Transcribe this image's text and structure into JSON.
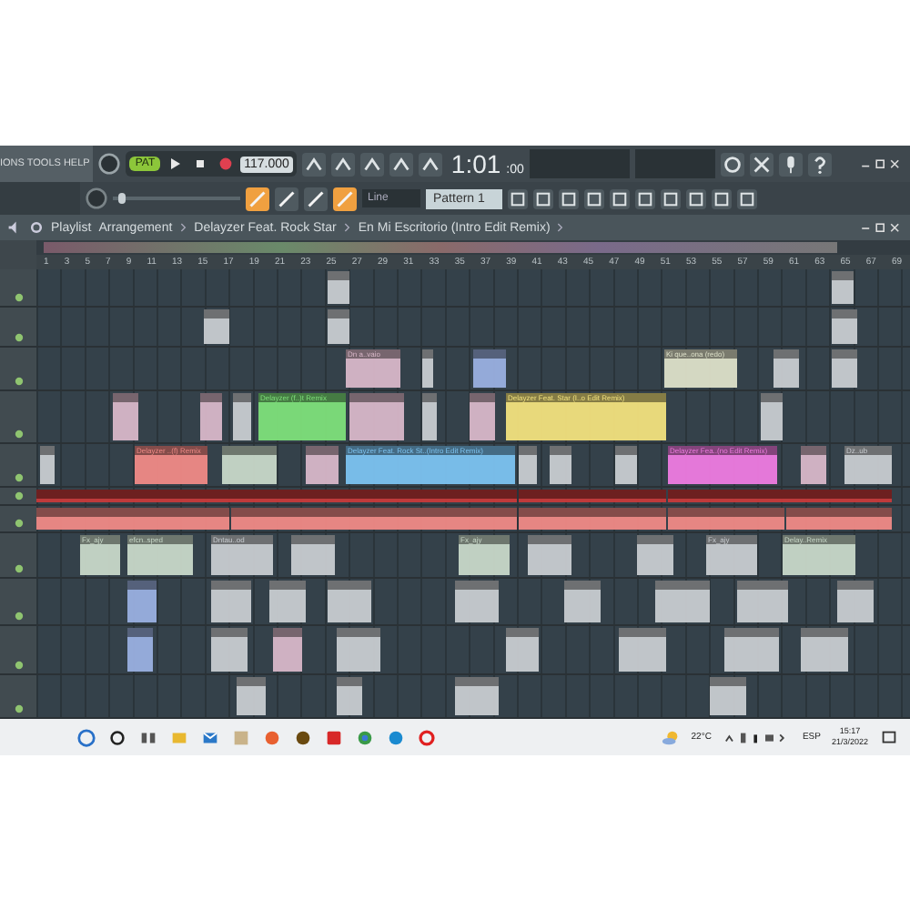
{
  "menu": {
    "text": "IONS TOOLS HELP"
  },
  "transport": {
    "mode": "PAT",
    "tempo": "117.000",
    "time": "1:01",
    "time_small": ":00"
  },
  "master": {
    "level": 0.05
  },
  "pattern": {
    "name": "Pattern 1"
  },
  "snap": {
    "value": "Line"
  },
  "playlist": {
    "title": "Playlist",
    "breadcrumb": [
      "Arrangement",
      "Delayzer Feat. Rock Star",
      "En Mi Escritorio (Intro Edit Remix)"
    ]
  },
  "ruler": [
    "1",
    "3",
    "5",
    "7",
    "9",
    "11",
    "13",
    "15",
    "17",
    "19",
    "21",
    "23",
    "25",
    "27",
    "29",
    "31",
    "33",
    "35",
    "37",
    "39",
    "41",
    "43",
    "45",
    "47",
    "49",
    "51",
    "53",
    "55",
    "57",
    "59",
    "61",
    "63",
    "65",
    "67",
    "69"
  ],
  "tracks": [
    {
      "clips": [
        {
          "color": "#c8ccd0"
        },
        {
          "color": "#c8ccd0"
        }
      ]
    },
    {
      "clips": [
        {
          "color": "#c8ccd0"
        },
        {
          "color": "#c8ccd0"
        },
        {
          "color": "#c8ccd0"
        }
      ]
    },
    {
      "clips": [
        {
          "label": "Dn a..vaio",
          "color": "#d8b7c8"
        },
        {
          "color": "#c8ccd0"
        },
        {
          "color": "#9ab0e0"
        },
        {
          "label": "Ki que..ona (redo)",
          "color": "#dde0c8"
        },
        {
          "color": "#c8ccd0"
        },
        {
          "color": "#c8ccd0"
        }
      ]
    },
    {
      "clips": [
        {
          "color": "#d8b7c8"
        },
        {
          "color": "#d8b7c8"
        },
        {
          "color": "#c8ccd0"
        },
        {
          "label": "Delayzer (f..)t Remix",
          "color": "#7ee07a"
        },
        {
          "color": "#d8b7c8"
        },
        {
          "color": "#c8ccd0"
        },
        {
          "color": "#d8b7c8"
        },
        {
          "label": "Delayzer Feat. Star (I..o Edit Remix)",
          "color": "#f2e27d"
        },
        {
          "color": "#c8ccd0"
        }
      ]
    },
    {
      "clips": [
        {
          "color": "#c8ccd0"
        },
        {
          "label": "Delayzer ..(f) Remix",
          "color": "#f08a86"
        },
        {
          "color": "#c8d8c8"
        },
        {
          "color": "#d8b7c8"
        },
        {
          "label": "Delayzer Feat. Rock St..(Intro Edit Remix)",
          "color": "#7cc3f0"
        },
        {
          "color": "#c8ccd0"
        },
        {
          "color": "#c8ccd0"
        },
        {
          "color": "#c8ccd0"
        },
        {
          "label": "Delayzer Fea..(no Edit Remix)",
          "color": "#ee7be0"
        },
        {
          "color": "#d8b7c8"
        },
        {
          "label": "Dz..ub",
          "color": "#c8ccd0"
        }
      ]
    },
    {
      "clips": [
        {
          "color": "#c73a3a"
        },
        {
          "color": "#c73a3a"
        },
        {
          "color": "#c73a3a"
        }
      ]
    },
    {
      "clips": [
        {
          "color": "#f08a86"
        },
        {
          "color": "#f08a86"
        },
        {
          "color": "#f08a86"
        },
        {
          "color": "#f08a86"
        },
        {
          "color": "#f08a86"
        }
      ]
    },
    {
      "clips": [
        {
          "label": "Fx_ajy",
          "color": "#c8d8c8"
        },
        {
          "label": "efcn..sped",
          "color": "#c8d8c8"
        },
        {
          "label": "Dntau..od",
          "color": "#c8ccd0"
        },
        {
          "color": "#c8ccd0"
        },
        {
          "label": "Fx_ajy",
          "color": "#c8d8c8"
        },
        {
          "color": "#c8ccd0"
        },
        {
          "color": "#c8ccd0"
        },
        {
          "label": "Fx_ajy",
          "color": "#c8ccd0"
        },
        {
          "label": "Delay..Remix",
          "color": "#c8d8c8"
        }
      ]
    },
    {
      "clips": [
        {
          "color": "#9ab0e0"
        },
        {
          "color": "#c8ccd0"
        },
        {
          "color": "#c8ccd0"
        },
        {
          "color": "#c8ccd0"
        },
        {
          "color": "#c8ccd0"
        },
        {
          "color": "#c8ccd0"
        },
        {
          "color": "#c8ccd0"
        },
        {
          "color": "#c8ccd0"
        },
        {
          "color": "#c8ccd0"
        }
      ]
    },
    {
      "clips": [
        {
          "color": "#9ab0e0"
        },
        {
          "color": "#c8ccd0"
        },
        {
          "color": "#d8b7c8"
        },
        {
          "color": "#c8ccd0"
        },
        {
          "color": "#c8ccd0"
        },
        {
          "color": "#c8ccd0"
        },
        {
          "color": "#c8ccd0"
        },
        {
          "color": "#c8ccd0"
        }
      ]
    },
    {
      "clips": [
        {
          "color": "#c8ccd0"
        },
        {
          "color": "#c8ccd0"
        },
        {
          "color": "#c8ccd0"
        },
        {
          "color": "#c8ccd0"
        }
      ]
    }
  ],
  "taskbar": {
    "weather": "22°C",
    "language": "ESP",
    "time": "15:17",
    "date": "21/3/2022"
  }
}
